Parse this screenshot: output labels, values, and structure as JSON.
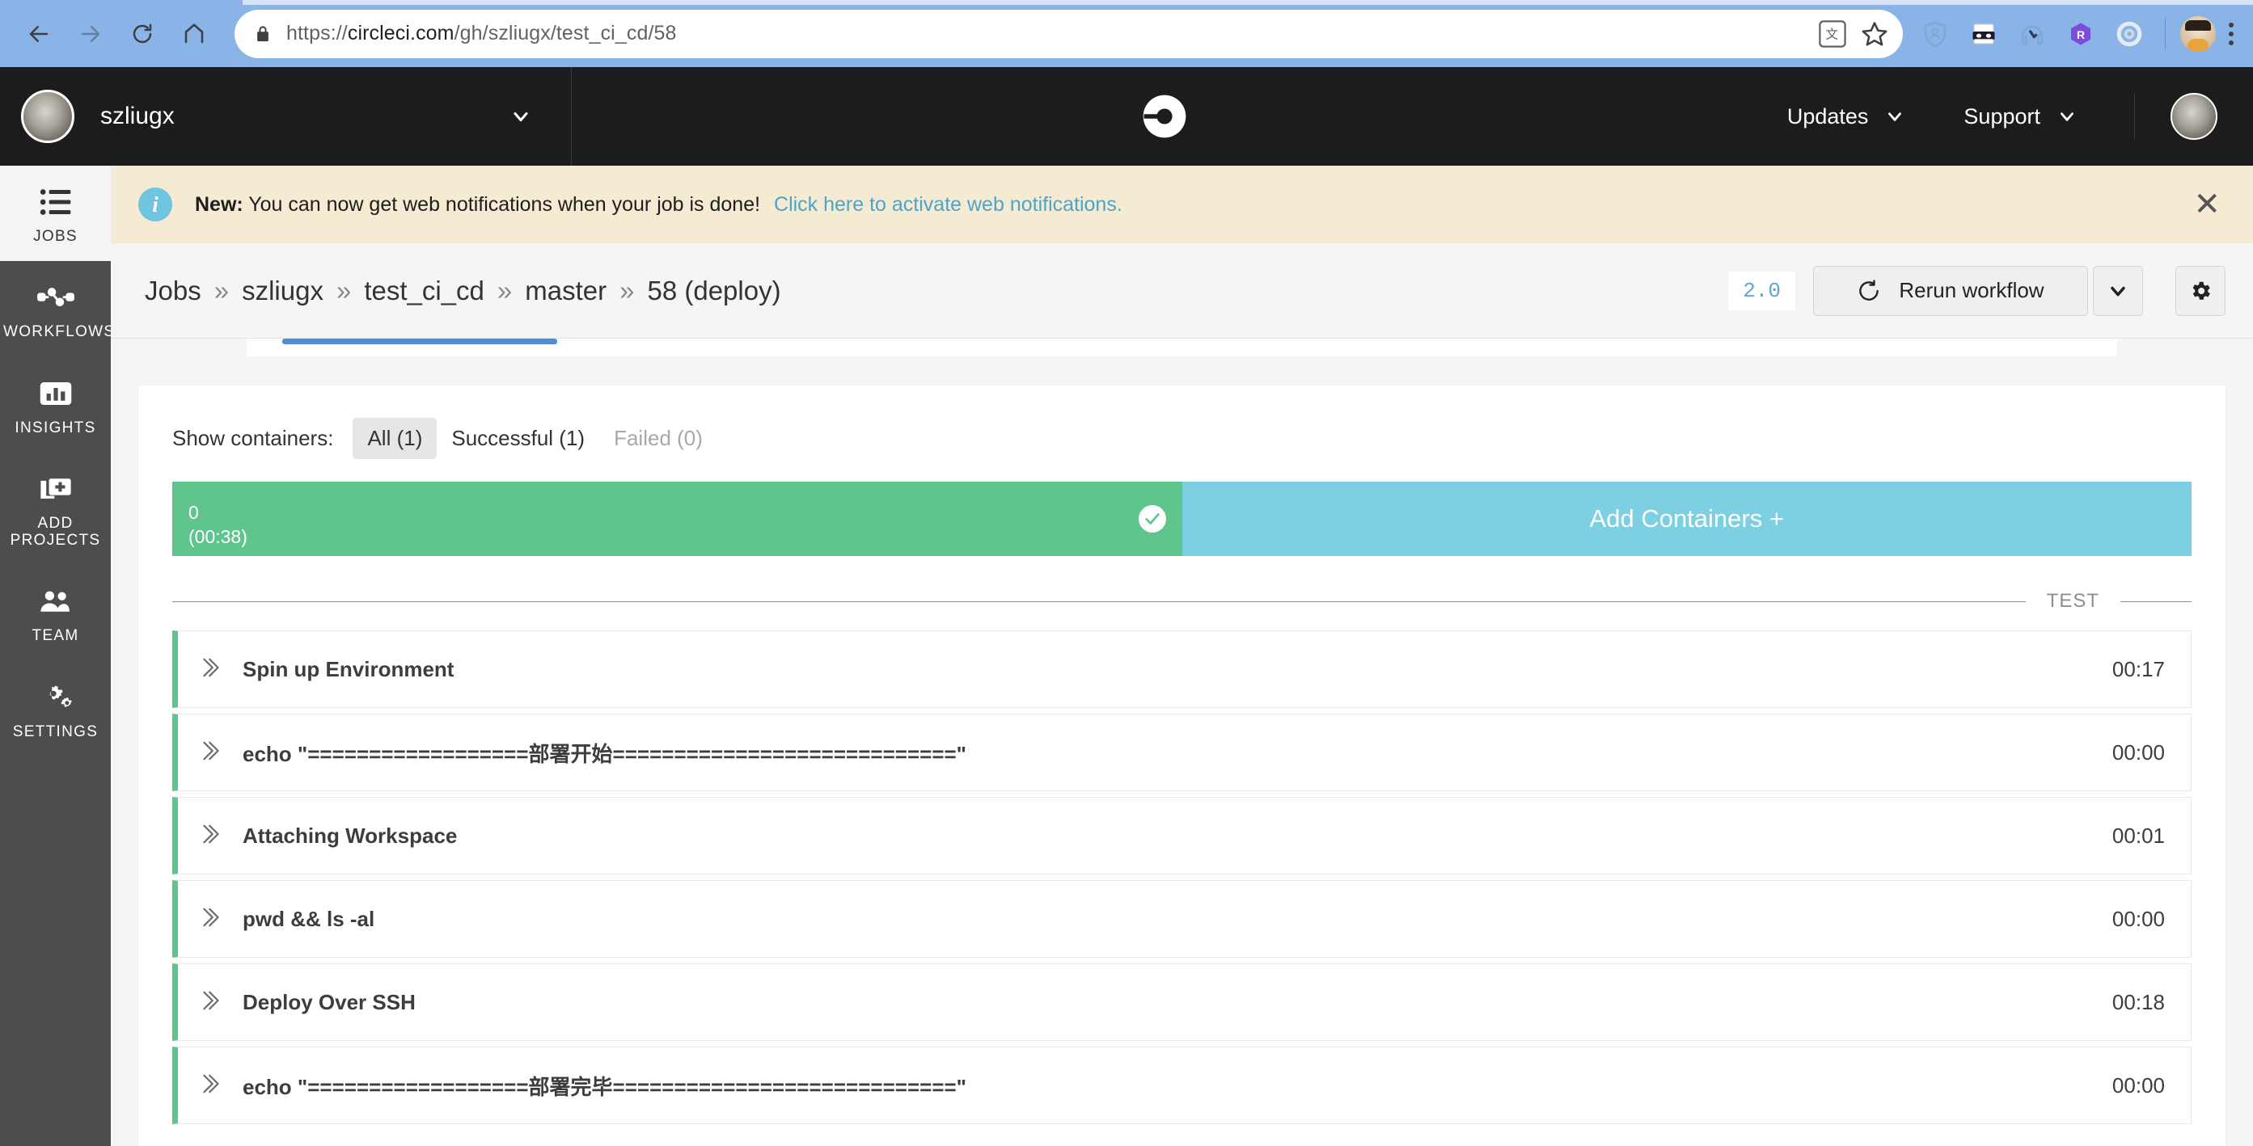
{
  "browser": {
    "url_scheme": "https://",
    "url_domain": "circleci.com",
    "url_path": "/gh/szliugx/test_ci_cd/58",
    "back_icon": "back-arrow-icon",
    "forward_icon": "forward-arrow-icon",
    "reload_icon": "reload-icon",
    "home_icon": "home-icon",
    "lock_icon": "lock-icon",
    "translate_icon": "translate-icon",
    "bookmark_icon": "star-icon",
    "extensions": [
      "shield-icon",
      "bandit-mask-icon",
      "ghost-headphones-icon",
      "r-hexagon-icon",
      "circleci-ring-icon"
    ],
    "profile_icon": "profile-avatar-icon",
    "menu_icon": "three-dot-menu-icon"
  },
  "header": {
    "org_name": "szliugx",
    "org_caret": "chevron-down-icon",
    "logo": "circleci-logo-icon",
    "nav": [
      {
        "label": "Updates",
        "caret": "chevron-down-icon"
      },
      {
        "label": "Support",
        "caret": "chevron-down-icon"
      }
    ],
    "avatar": "user-avatar-icon"
  },
  "sidebar": {
    "items": [
      {
        "label": "JOBS",
        "icon": "jobs-list-icon",
        "active": true
      },
      {
        "label": "WORKFLOWS",
        "icon": "workflows-icon",
        "active": false
      },
      {
        "label": "INSIGHTS",
        "icon": "insights-chart-icon",
        "active": false
      },
      {
        "label": "ADD PROJECTS",
        "icon": "add-project-icon",
        "active": false
      },
      {
        "label": "TEAM",
        "icon": "team-people-icon",
        "active": false
      },
      {
        "label": "SETTINGS",
        "icon": "settings-gears-icon",
        "active": false
      }
    ]
  },
  "banner": {
    "icon": "info-circle-icon",
    "bold_prefix": "New:",
    "message": "You can now get web notifications when your job is done!",
    "link": "Click here to activate web notifications.",
    "close_icon": "close-x-icon"
  },
  "breadcrumb": {
    "segments": [
      "Jobs",
      "szliugx",
      "test_ci_cd",
      "master",
      "58 (deploy)"
    ],
    "separator": "»"
  },
  "toolbar": {
    "version_badge": "2.0",
    "rerun_label": "Rerun workflow",
    "rerun_icon": "refresh-icon",
    "dropdown_icon": "chevron-down-icon",
    "settings_icon": "gear-icon"
  },
  "containers": {
    "show_label": "Show containers:",
    "filters": [
      {
        "label": "All (1)",
        "state": "active"
      },
      {
        "label": "Successful (1)",
        "state": "normal"
      },
      {
        "label": "Failed (0)",
        "state": "disabled"
      }
    ],
    "bar": {
      "index": "0",
      "duration": "(00:38)",
      "status_icon": "check-circle-icon",
      "color": "#5ec58d"
    },
    "add_label": "Add Containers +",
    "add_color": "#7cd0e2"
  },
  "section": {
    "title": "TEST"
  },
  "steps": [
    {
      "name": "Spin up Environment",
      "time": "00:17",
      "chevron": "double-chevron-right-icon"
    },
    {
      "name": "echo \"==================部署开始============================\"",
      "time": "00:00",
      "chevron": "double-chevron-right-icon"
    },
    {
      "name": "Attaching Workspace",
      "time": "00:01",
      "chevron": "double-chevron-right-icon"
    },
    {
      "name": "pwd && ls -al",
      "time": "00:00",
      "chevron": "double-chevron-right-icon"
    },
    {
      "name": "Deploy Over SSH",
      "time": "00:18",
      "chevron": "double-chevron-right-icon"
    },
    {
      "name": "echo \"==================部署完毕============================\"",
      "time": "00:00",
      "chevron": "double-chevron-right-icon"
    }
  ]
}
